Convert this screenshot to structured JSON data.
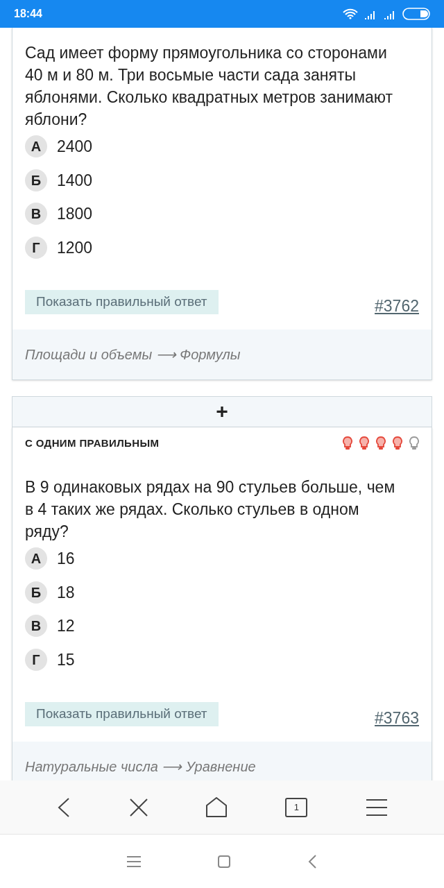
{
  "status_bar": {
    "time": "18:44"
  },
  "cards": [
    {
      "question": "Сад имеет форму прямоугольника со сторонами 40 м и 80 м. Три восьмые части сада заняты яблонями. Сколько квадратных метров занимают яблони?",
      "options": [
        {
          "letter": "А",
          "text": "2400"
        },
        {
          "letter": "Б",
          "text": "1400"
        },
        {
          "letter": "В",
          "text": "1800"
        },
        {
          "letter": "Г",
          "text": "1200"
        }
      ],
      "show_answer": "Показать правильный ответ",
      "number": "#3762",
      "topic": "Площади и объемы ⟶ Формулы"
    },
    {
      "header": "С ОДНИМ ПРАВИЛЬНЫМ",
      "stars": 4,
      "question": "В 9 одинаковых рядах на 90 стульев больше, чем в 4 таких же рядах. Сколько стульев в одном ряду?",
      "options": [
        {
          "letter": "А",
          "text": "16"
        },
        {
          "letter": "Б",
          "text": "18"
        },
        {
          "letter": "В",
          "text": "12"
        },
        {
          "letter": "Г",
          "text": "15"
        }
      ],
      "show_answer": "Показать правильный ответ",
      "number": "#3763",
      "topic": "Натуральные числа ⟶ Уравнение"
    }
  ],
  "add_button": "+",
  "browser_toolbar": {
    "tab_count": "1"
  }
}
